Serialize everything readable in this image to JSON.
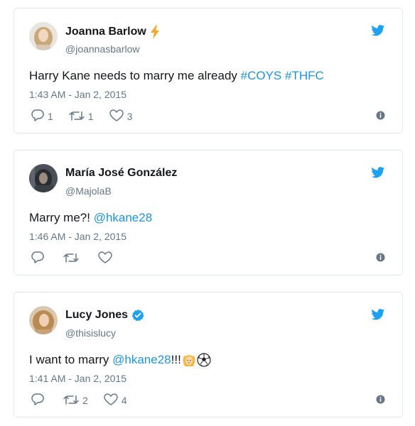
{
  "tweets": [
    {
      "name": "Joanna Barlow",
      "badge": "lightning-icon",
      "handle": "@joannasbarlow",
      "text_plain": "Harry Kane needs to marry me already ",
      "hashtags": [
        "#COYS",
        "#THFC"
      ],
      "time": "1:43 AM - Jan 2, 2015",
      "replies": "1",
      "retweets": "1",
      "likes": "3"
    },
    {
      "name": "María José González",
      "handle": "@MajolaB",
      "text_plain": "Marry me?! ",
      "mention": "@hkane28",
      "time": "1:46 AM - Jan 2, 2015",
      "replies": "",
      "retweets": "",
      "likes": ""
    },
    {
      "name": "Lucy Jones",
      "badge": "verified-icon",
      "handle": "@thisislucy",
      "text_plain": "I want to marry ",
      "mention": "@hkane28",
      "text_after": "!!!",
      "emojis": [
        "bride-emoji",
        "soccer-ball-emoji"
      ],
      "time": "1:41 AM - Jan 2, 2015",
      "replies": "",
      "retweets": "2",
      "likes": "4"
    }
  ],
  "colors": {
    "link": "#1b95e0",
    "twitter_blue": "#1da1f2",
    "muted": "#657786",
    "border": "#e1e8ed",
    "lightning": "#f5a623"
  },
  "icons": {
    "brand": "twitter-bird-icon",
    "reply": "reply-icon",
    "retweet": "retweet-icon",
    "like": "heart-icon",
    "info": "info-icon"
  }
}
